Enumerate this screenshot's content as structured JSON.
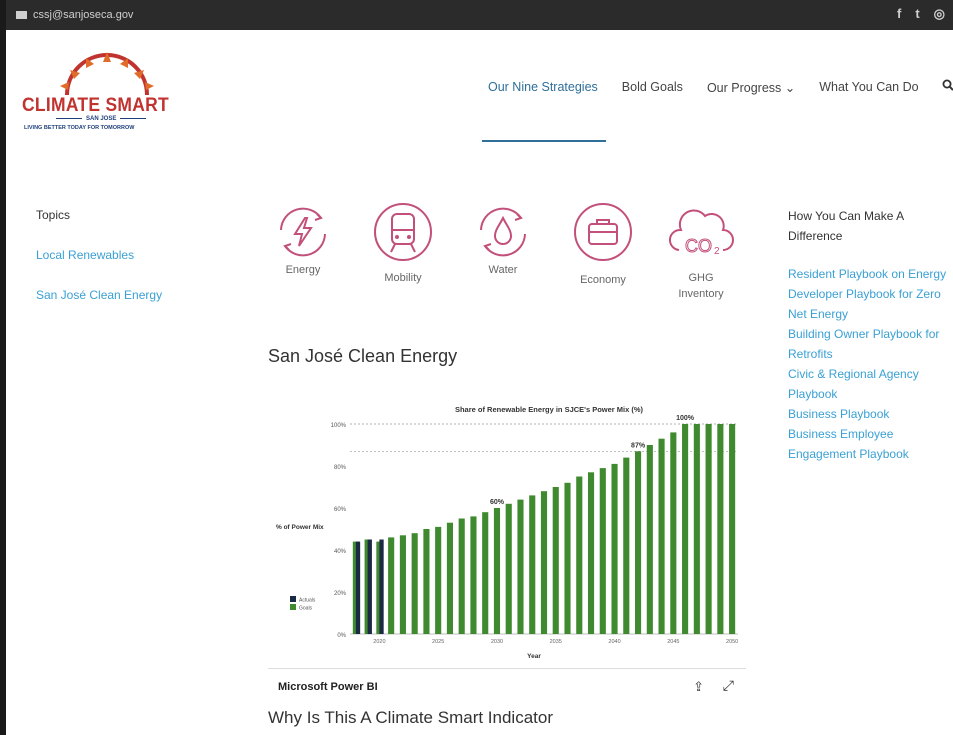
{
  "topbar": {
    "email": "cssj@sanjoseca.gov",
    "social": [
      "f",
      "t",
      "in"
    ],
    "social_icons": [
      "facebook-icon",
      "twitter-icon",
      "instagram-icon"
    ]
  },
  "logo": {
    "title": "CLIMATE SMART",
    "city": "SAN JOSE",
    "tagline": "LIVING BETTER TODAY FOR TOMORROW"
  },
  "nav": {
    "items": [
      "Our Nine Strategies",
      "Bold Goals",
      "Our Progress ⌄",
      "What You Can Do"
    ],
    "active_index": 0
  },
  "left": {
    "heading": "Topics",
    "links": [
      "Local Renewables",
      "San José Clean Energy"
    ]
  },
  "icons": [
    {
      "label": "Energy",
      "name": "energy-icon"
    },
    {
      "label": "Mobility",
      "name": "mobility-icon"
    },
    {
      "label": "Water",
      "name": "water-icon"
    },
    {
      "label": "Economy",
      "name": "economy-icon"
    },
    {
      "label": "GHG\nInventory",
      "name": "ghg-icon"
    }
  ],
  "section_title": "San José Clean Energy",
  "chart_footer": {
    "brand": "Microsoft Power BI"
  },
  "bottom_title": "Why Is This A Climate Smart Indicator",
  "right": {
    "heading": "How You Can Make A Difference",
    "links": [
      "Resident Playbook on Energy",
      "Developer Playbook for Zero Net Energy",
      "Building Owner Playbook for Retrofits",
      "Civic & Regional Agency Playbook",
      "Business Playbook",
      "Business Employee Engagement Playbook"
    ]
  },
  "colors": {
    "accent": "#c0332f",
    "link": "#3aa0d4",
    "icon": "#c2507a",
    "goals": "#3f8a2e",
    "actuals": "#1a2a44"
  },
  "chart_data": {
    "type": "bar",
    "title": "Share of Renewable Energy in SJCE's Power Mix (%)",
    "xlabel": "Year",
    "ylabel": "% of Power Mix",
    "ylim": [
      0,
      100
    ],
    "yticks": [
      "0%",
      "20%",
      "40%",
      "60%",
      "80%",
      "100%"
    ],
    "xtick_labels": [
      "2020",
      "2025",
      "2030",
      "2035",
      "2040",
      "2045",
      "2050"
    ],
    "categories": [
      2018,
      2019,
      2020,
      2021,
      2022,
      2023,
      2024,
      2025,
      2026,
      2027,
      2028,
      2029,
      2030,
      2031,
      2032,
      2033,
      2034,
      2035,
      2036,
      2037,
      2038,
      2039,
      2040,
      2041,
      2042,
      2043,
      2044,
      2045,
      2046,
      2047,
      2048,
      2049,
      2050
    ],
    "series": [
      {
        "name": "Actuals",
        "values": [
          44,
          45,
          45,
          null,
          null,
          null,
          null,
          null,
          null,
          null,
          null,
          null,
          null,
          null,
          null,
          null,
          null,
          null,
          null,
          null,
          null,
          null,
          null,
          null,
          null,
          null,
          null,
          null,
          null,
          null,
          null,
          null,
          null
        ]
      },
      {
        "name": "Goals",
        "values": [
          44,
          45,
          44,
          46,
          47,
          48,
          50,
          51,
          53,
          55,
          56,
          58,
          60,
          62,
          64,
          66,
          68,
          70,
          72,
          75,
          77,
          79,
          81,
          84,
          87,
          90,
          93,
          96,
          100,
          100,
          100,
          100,
          100
        ]
      }
    ],
    "data_labels": [
      {
        "x": 2030,
        "label": "60%"
      },
      {
        "x": 2042,
        "label": "87%"
      },
      {
        "x": 2046,
        "label": "100%"
      }
    ],
    "legend": [
      "Actuals",
      "Goals"
    ],
    "legend_position": "bottom-left",
    "reference_lines": [
      100,
      87
    ]
  }
}
